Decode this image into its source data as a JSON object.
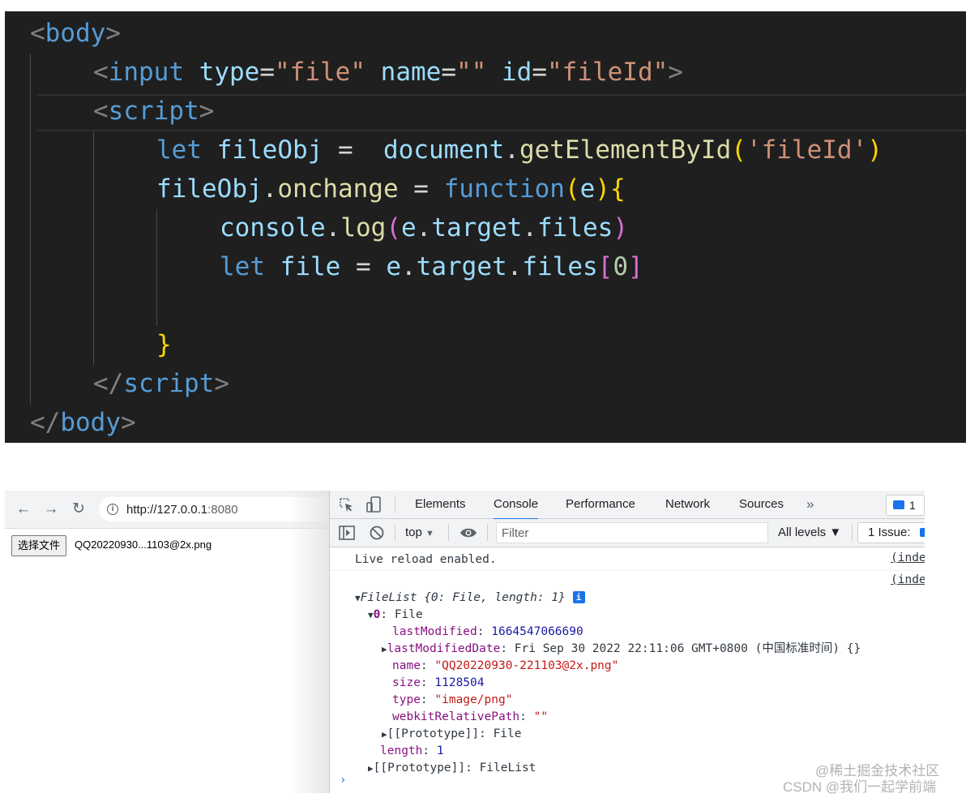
{
  "editor": {
    "lines": [
      {
        "parts": [
          [
            "c-punc",
            "<"
          ],
          [
            "c-tag",
            "body"
          ],
          [
            "c-punc",
            ">"
          ]
        ]
      },
      {
        "parts": [
          [
            "c-punc",
            "<"
          ],
          [
            "c-tag",
            "input"
          ],
          [
            "c-txt",
            " "
          ],
          [
            "c-attr",
            "type"
          ],
          [
            "c-txt",
            "="
          ],
          [
            "c-str",
            "\"file\""
          ],
          [
            "c-txt",
            " "
          ],
          [
            "c-attr",
            "name"
          ],
          [
            "c-txt",
            "="
          ],
          [
            "c-str",
            "\"\""
          ],
          [
            "c-txt",
            " "
          ],
          [
            "c-attr",
            "id"
          ],
          [
            "c-txt",
            "="
          ],
          [
            "c-str",
            "\"fileId\""
          ],
          [
            "c-punc",
            ">"
          ]
        ]
      },
      {
        "parts": [
          [
            "c-punc",
            "<"
          ],
          [
            "c-tag",
            "script"
          ],
          [
            "c-punc",
            ">"
          ]
        ]
      },
      {
        "parts": [
          [
            "c-kw",
            "let"
          ],
          [
            "c-txt",
            " "
          ],
          [
            "c-var",
            "fileObj"
          ],
          [
            "c-txt",
            " =  "
          ],
          [
            "c-var",
            "document"
          ],
          [
            "c-txt",
            "."
          ],
          [
            "c-fn",
            "getElementById"
          ],
          [
            "c-b1",
            "("
          ],
          [
            "c-str",
            "'fileId'"
          ],
          [
            "c-b1",
            ")"
          ]
        ]
      },
      {
        "parts": [
          [
            "c-var",
            "fileObj"
          ],
          [
            "c-txt",
            "."
          ],
          [
            "c-fn",
            "onchange"
          ],
          [
            "c-txt",
            " = "
          ],
          [
            "c-kw",
            "function"
          ],
          [
            "c-b1",
            "("
          ],
          [
            "c-var",
            "e"
          ],
          [
            "c-b1",
            ")"
          ],
          [
            "c-b1",
            "{"
          ]
        ]
      },
      {
        "parts": [
          [
            "c-var",
            "console"
          ],
          [
            "c-txt",
            "."
          ],
          [
            "c-fn",
            "log"
          ],
          [
            "c-b2",
            "("
          ],
          [
            "c-var",
            "e"
          ],
          [
            "c-txt",
            "."
          ],
          [
            "c-var",
            "target"
          ],
          [
            "c-txt",
            "."
          ],
          [
            "c-var",
            "files"
          ],
          [
            "c-b2",
            ")"
          ]
        ]
      },
      {
        "parts": [
          [
            "c-kw",
            "let"
          ],
          [
            "c-txt",
            " "
          ],
          [
            "c-var",
            "file"
          ],
          [
            "c-txt",
            " = "
          ],
          [
            "c-var",
            "e"
          ],
          [
            "c-txt",
            "."
          ],
          [
            "c-var",
            "target"
          ],
          [
            "c-txt",
            "."
          ],
          [
            "c-var",
            "files"
          ],
          [
            "c-b2",
            "["
          ],
          [
            "c-num",
            "0"
          ],
          [
            "c-b2",
            "]"
          ]
        ]
      },
      {
        "parts": []
      },
      {
        "parts": [
          [
            "c-b1",
            "}"
          ]
        ]
      },
      {
        "parts": [
          [
            "c-punc",
            "</"
          ],
          [
            "c-tag",
            "script"
          ],
          [
            "c-punc",
            ">"
          ]
        ]
      },
      {
        "parts": [
          [
            "c-punc",
            "</"
          ],
          [
            "c-tag",
            "body"
          ],
          [
            "c-punc",
            ">"
          ]
        ]
      }
    ]
  },
  "browser": {
    "back_icon": "←",
    "forward_icon": "→",
    "reload_icon": "↻",
    "url_host": "http://127.0.0.1",
    "url_port": ":8080",
    "file_button_label": "选择文件",
    "file_name": "QQ20220930...1103@2x.png"
  },
  "devtools": {
    "tabs": [
      "Elements",
      "Console",
      "Performance",
      "Network",
      "Sources"
    ],
    "active_tab": "Console",
    "more_tabs_icon": "»",
    "issues_count": "1",
    "context": "top",
    "filter_placeholder": "Filter",
    "levels": "All levels ▼",
    "issue_label": "1 Issue:",
    "console": {
      "live_reload": "Live reload enabled.",
      "src_link": "(inde",
      "filelist_header": "FileList {0: File, length: 1}",
      "entry_index": "0",
      "entry_type": "File",
      "fields": [
        {
          "key": "lastModified",
          "value": "1664547066690",
          "kind": "k-blue",
          "expandable": false
        },
        {
          "key": "lastModifiedDate",
          "value": "Fri Sep 30 2022 22:11:06 GMT+0800 (中国标准时间) {}",
          "kind": "k-dark",
          "expandable": true
        },
        {
          "key": "name",
          "value": "\"QQ20220930-221103@2x.png\"",
          "kind": "k-red",
          "expandable": false
        },
        {
          "key": "size",
          "value": "1128504",
          "kind": "k-blue",
          "expandable": false
        },
        {
          "key": "type",
          "value": "\"image/png\"",
          "kind": "k-red",
          "expandable": false
        },
        {
          "key": "webkitRelativePath",
          "value": "\"\"",
          "kind": "k-red",
          "expandable": false
        }
      ],
      "file_proto": "[[Prototype]]: File",
      "length_key": "length",
      "length_value": "1",
      "list_proto": "[[Prototype]]: FileList",
      "prompt": "›"
    }
  },
  "watermark": {
    "line1": "@稀土掘金技术社区",
    "line2": "CSDN @我们一起学前端"
  }
}
